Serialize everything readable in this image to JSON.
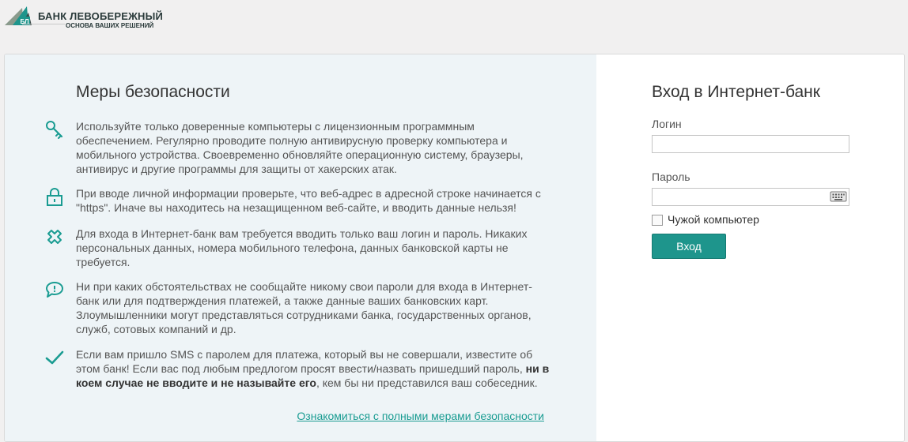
{
  "logo": {
    "name": "БАНК ЛЕВОБЕРЕЖНЫЙ",
    "tagline": "ОСНОВА ВАШИХ РЕШЕНИЙ",
    "mark_text": "БЛ"
  },
  "security": {
    "title": "Меры безопасности",
    "items": [
      {
        "icon": "key-icon",
        "text": "Используйте только доверенные компьютеры с лицензионным программным обеспечением. Регулярно проводите полную антивирусную проверку компьютера и мобильного устройства. Своевременно обновляйте операционную систему, браузеры, антивирус и другие программы для защиты от хакерских атак."
      },
      {
        "icon": "lock-icon",
        "text": "При вводе личной информации проверьте, что веб-адрес в адресной строке начинается с \"https\". Иначе вы находитесь на незащищенном веб-сайте, и вводить данные нельзя!"
      },
      {
        "icon": "cross-icon",
        "text": "Для входа в Интернет-банк вам требуется вводить только ваш логин и пароль. Никаких персональных данных, номера мобильного телефона, данных банковской карты не требуется."
      },
      {
        "icon": "speech-bubble-icon",
        "text": "Ни при каких обстоятельствах не сообщайте никому свои пароли для входа в Интернет-банк или для подтверждения платежей, а также данные ваших банковских карт. Злоумышленники могут представляться сотрудниками банка, государственных органов, служб, сотовых компаний и др."
      },
      {
        "icon": "checkmark-icon",
        "text_before": "Если вам пришло SMS с паролем для платежа, который вы не совершали, известите об этом банк! Если вас под любым предлогом просят ввести/назвать пришедший пароль, ",
        "text_bold": "ни в коем случае не вводите и не называйте его",
        "text_after": ", кем бы ни представился ваш собеседник."
      }
    ],
    "link": "Ознакомиться с полными мерами безопасности"
  },
  "login": {
    "title": "Вход в Интернет-банк",
    "login_label": "Логин",
    "login_value": "",
    "password_label": "Пароль",
    "password_value": "",
    "keyboard_icon": "keyboard-icon",
    "checkbox_label": "Чужой компьютер",
    "checkbox_checked": false,
    "submit_label": "Вход"
  },
  "colors": {
    "accent": "#1e958c",
    "link": "#1a9c92",
    "left_panel_bg": "#eef4f7"
  }
}
